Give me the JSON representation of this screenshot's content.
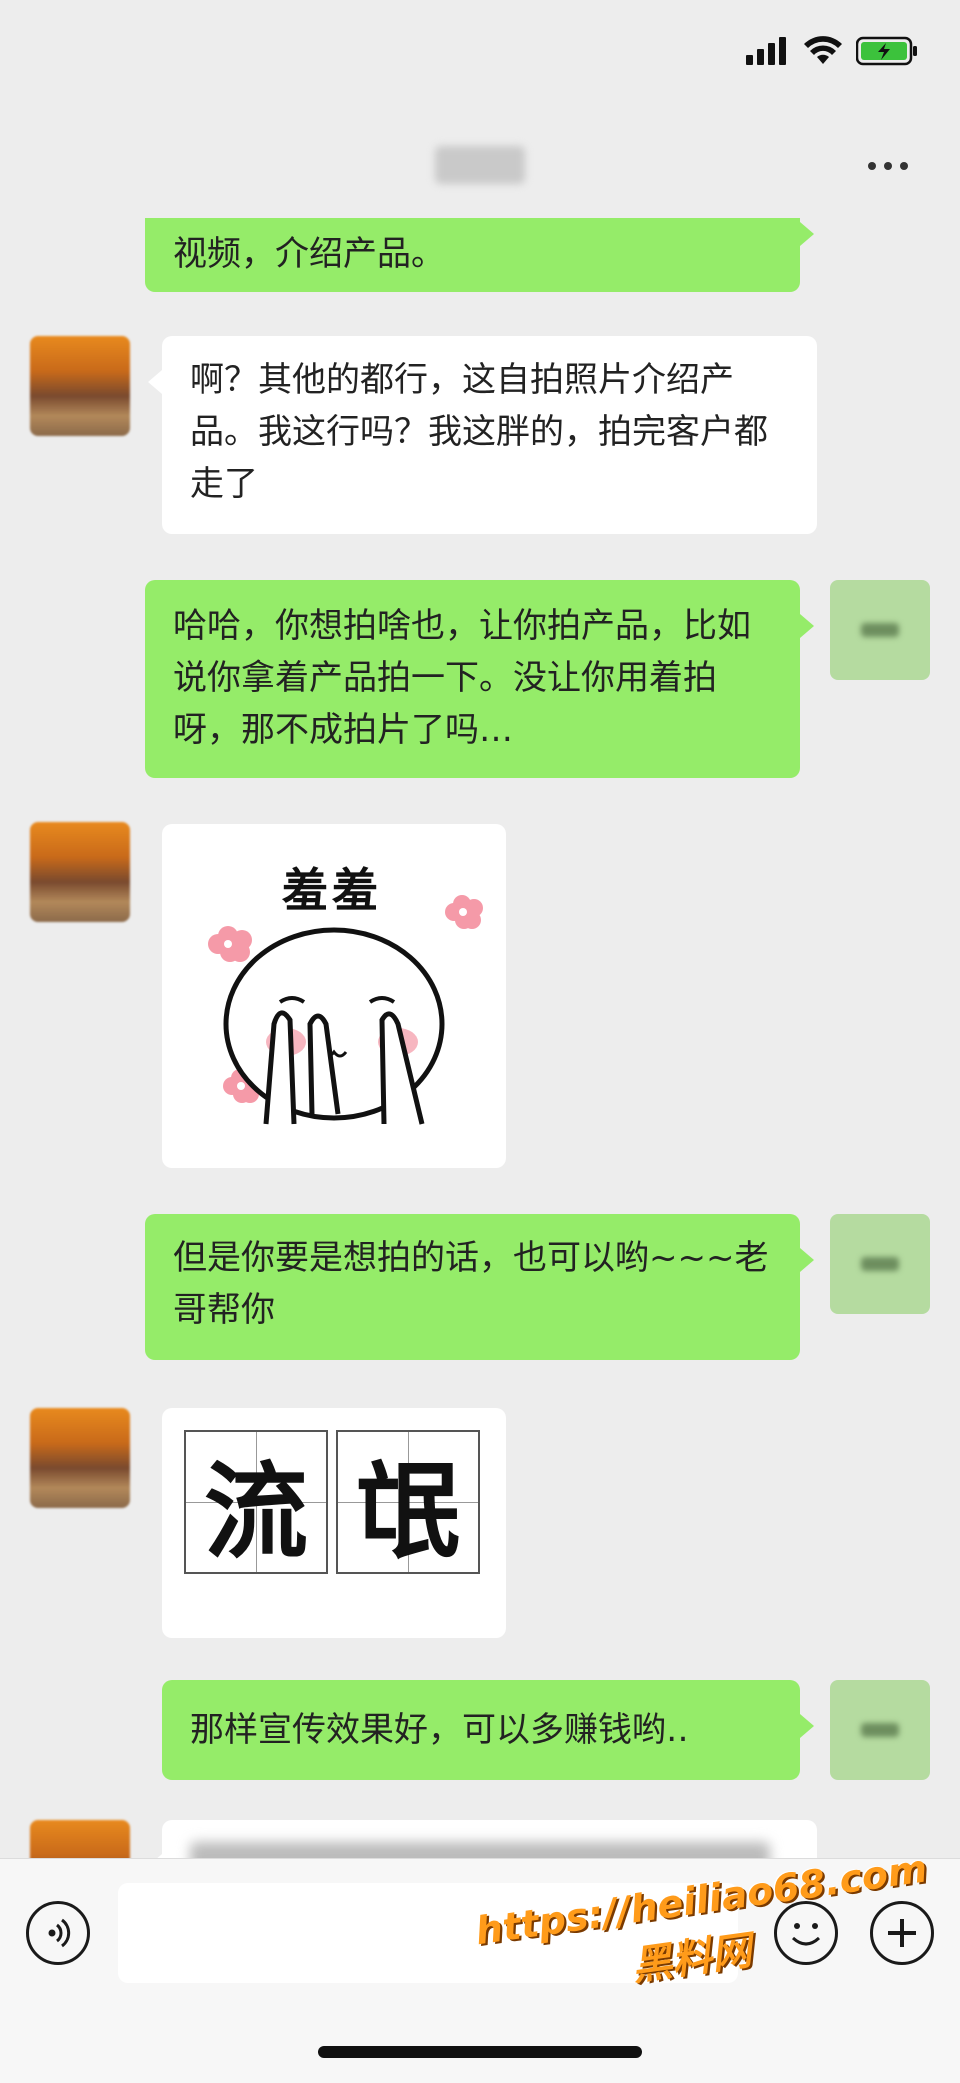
{
  "status_bar": {
    "signal_icon": "cellular-signal-icon",
    "wifi_icon": "wifi-icon",
    "battery_icon": "battery-charging-icon"
  },
  "header": {
    "more_icon": "more-dots-icon"
  },
  "messages": [
    {
      "side": "out",
      "text": "视频，介绍产品。"
    },
    {
      "side": "in",
      "text": "啊？其他的都行，这自拍照片介绍产品。我这行吗？我这胖的，拍完客户都走了"
    },
    {
      "side": "out",
      "text": "哈哈，你想拍啥也，让你拍产品，比如说你拿着产品拍一下。没让你用着拍呀，那不成拍片了吗…"
    },
    {
      "side": "in",
      "type": "sticker",
      "caption": "羞羞"
    },
    {
      "side": "out",
      "text": "但是你要是想拍的话，也可以哟~~~老哥帮你"
    },
    {
      "side": "in",
      "type": "sticker",
      "chars": [
        "流",
        "氓"
      ]
    },
    {
      "side": "out",
      "text": "那样宣传效果好，可以多赚钱哟‥"
    }
  ],
  "input_bar": {
    "voice_icon": "voice-icon",
    "emoji_icon": "emoji-icon",
    "plus_icon": "plus-icon",
    "input_value": ""
  },
  "watermark": {
    "url": "https://heiliao68.com",
    "name": "黑料网"
  }
}
